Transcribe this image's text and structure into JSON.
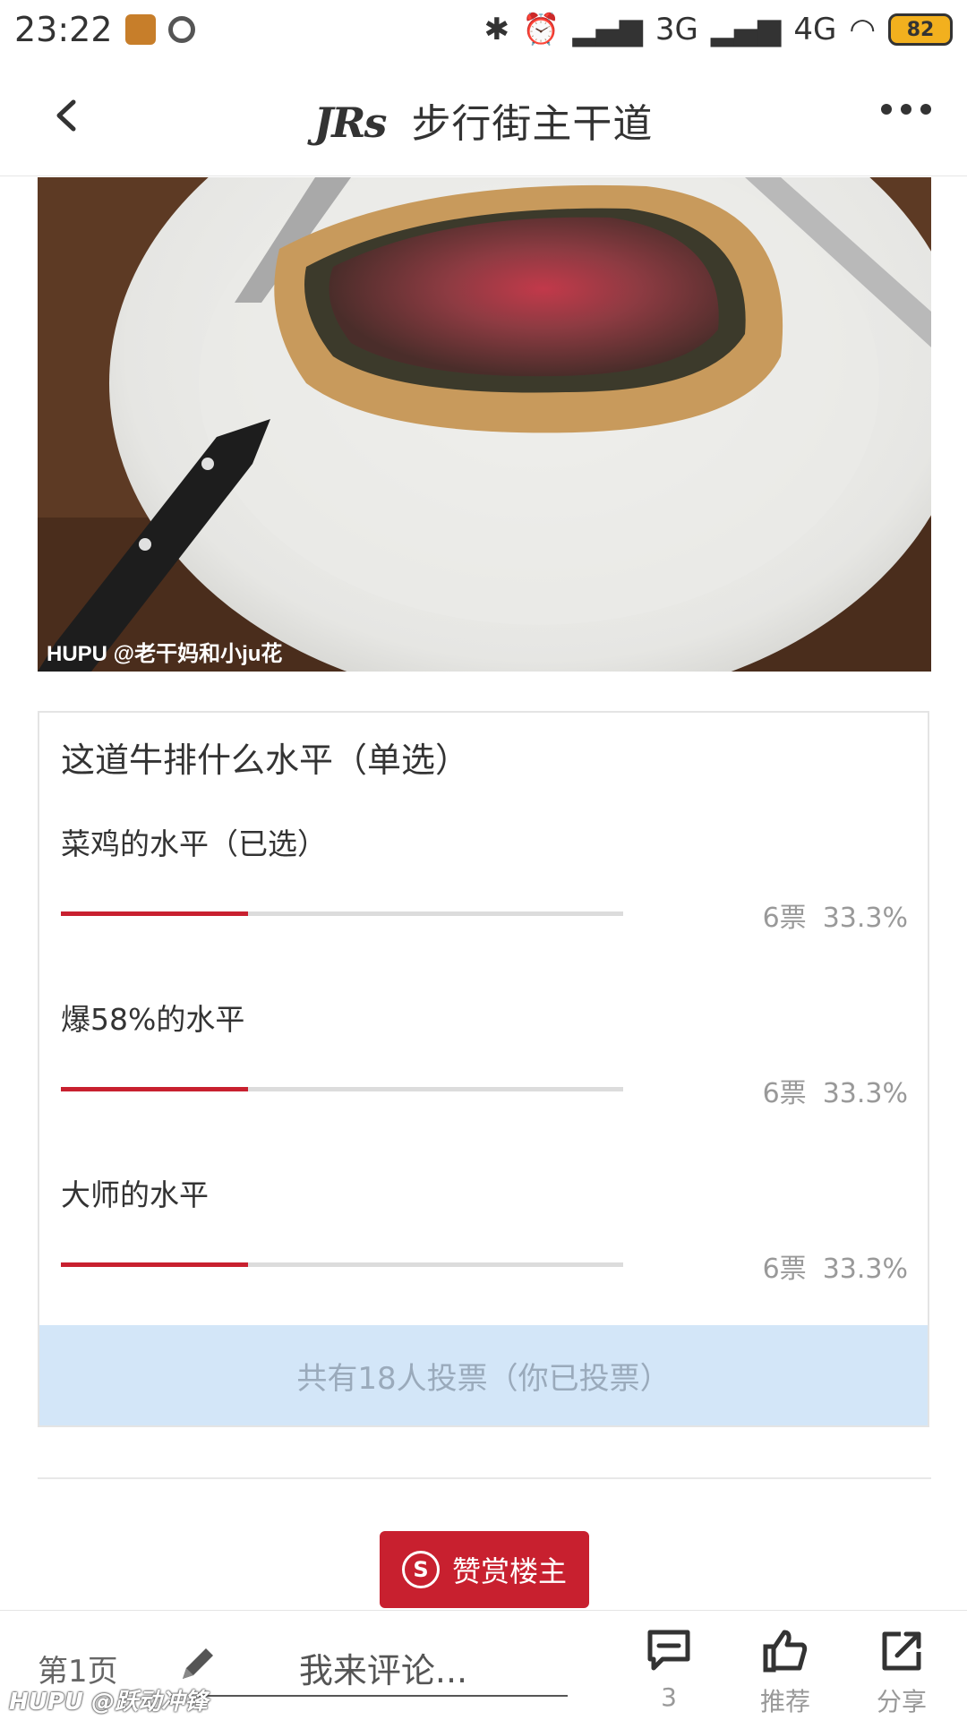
{
  "status_bar": {
    "time": "23:22",
    "net1": "3G",
    "net2": "4G",
    "battery": "82"
  },
  "nav": {
    "logo": "JRs",
    "title": "步行街主干道"
  },
  "photo": {
    "caption": "HUPU @老干妈和小ju花"
  },
  "poll": {
    "title": "这道牛排什么水平（单选）",
    "options": [
      {
        "label": "菜鸡的水平（已选）",
        "votes": "6票",
        "percent": "33.3%",
        "fraction": 0.333
      },
      {
        "label": "爆58%的水平",
        "votes": "6票",
        "percent": "33.3%",
        "fraction": 0.333
      },
      {
        "label": "大师的水平",
        "votes": "6票",
        "percent": "33.3%",
        "fraction": 0.333
      }
    ],
    "footer": "共有18人投票（你已投票）"
  },
  "tip_button": {
    "icon_letter": "S",
    "label": "赞赏楼主"
  },
  "bottom_bar": {
    "page": "第1页",
    "comment_placeholder": "我来评论...",
    "comment_count": "3",
    "recommend": "推荐",
    "share": "分享"
  },
  "watermark": "HUPU @跃动冲锋",
  "colors": {
    "accent_red": "#c8202f",
    "poll_footer_bg": "#d3e6f8"
  }
}
